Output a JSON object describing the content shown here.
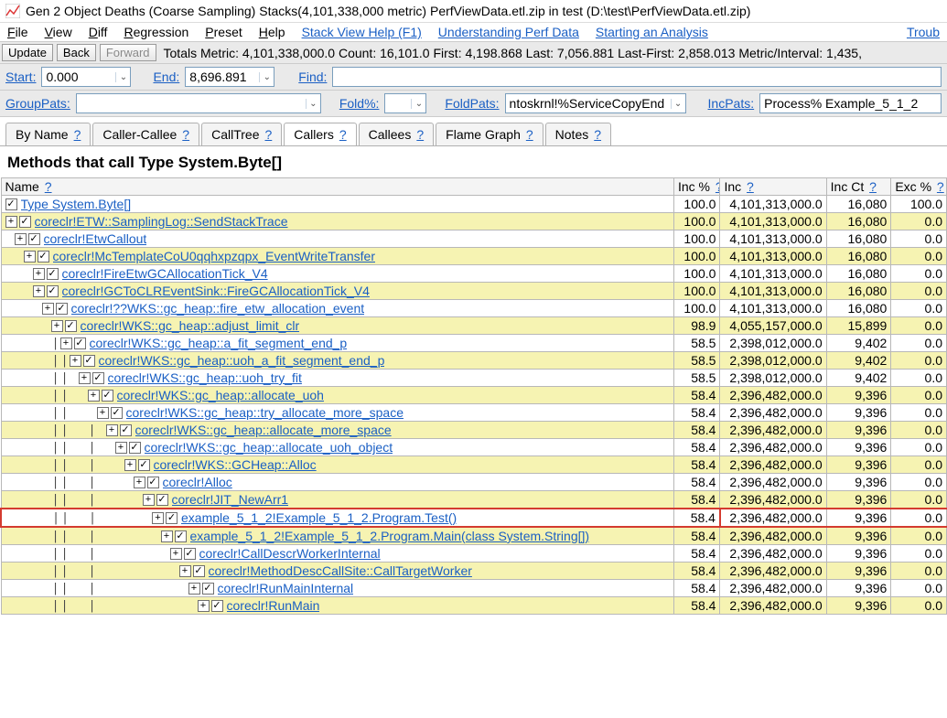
{
  "window": {
    "title": "Gen 2 Object Deaths (Coarse Sampling) Stacks(4,101,338,000 metric) PerfViewData.etl.zip in test (D:\\test\\PerfViewData.etl.zip)"
  },
  "menu": {
    "file": "File",
    "view": "View",
    "diff": "Diff",
    "regression": "Regression",
    "preset": "Preset",
    "help": "Help",
    "stack_view_help": "Stack View Help (F1)",
    "understanding": "Understanding Perf Data",
    "starting": "Starting an Analysis",
    "trouble": "Troub"
  },
  "toolbar": {
    "update": "Update",
    "back": "Back",
    "forward": "Forward",
    "stats": "Totals Metric: 4,101,338,000.0  Count: 16,101.0  First: 4,198.868 Last: 7,056.881  Last-First: 2,858.013  Metric/Interval: 1,435,"
  },
  "filters1": {
    "start_label": "Start:",
    "start_value": "0.000",
    "end_label": "End:",
    "end_value": "8,696.891",
    "find_label": "Find:",
    "find_value": ""
  },
  "filters2": {
    "group_label": "GroupPats:",
    "group_value": "",
    "foldpct_label": "Fold%:",
    "foldpct_value": "",
    "foldpats_label": "FoldPats:",
    "foldpats_value": "ntoskrnl!%ServiceCopyEnd",
    "incpats_label": "IncPats:",
    "incpats_value": "Process% Example_5_1_2"
  },
  "tabs": {
    "byname": "By Name",
    "callercallee": "Caller-Callee",
    "calltree": "CallTree",
    "callers": "Callers",
    "callees": "Callees",
    "flame": "Flame Graph",
    "notes": "Notes",
    "q": "?"
  },
  "heading": "Methods that call Type System.Byte[]",
  "columns": {
    "name": "Name",
    "incpct": "Inc %",
    "inc": "Inc",
    "incct": "Inc Ct",
    "excpct": "Exc %",
    "q": "?"
  },
  "rows": [
    {
      "depth": 0,
      "pipes": "",
      "hl": false,
      "label": "Type System.Byte[]",
      "incpct": "100.0",
      "inc": "4,101,313,000.0",
      "incct": "16,080",
      "excpct": "100.0"
    },
    {
      "depth": 0,
      "pipes": "+",
      "hl": true,
      "label": "coreclr!ETW::SamplingLog::SendStackTrace",
      "incpct": "100.0",
      "inc": "4,101,313,000.0",
      "incct": "16,080",
      "excpct": "0.0"
    },
    {
      "depth": 1,
      "pipes": "+",
      "hl": false,
      "label": "coreclr!EtwCallout",
      "incpct": "100.0",
      "inc": "4,101,313,000.0",
      "incct": "16,080",
      "excpct": "0.0"
    },
    {
      "depth": 2,
      "pipes": "+",
      "hl": true,
      "label": "coreclr!McTemplateCoU0qqhxpzqpx_EventWriteTransfer",
      "incpct": "100.0",
      "inc": "4,101,313,000.0",
      "incct": "16,080",
      "excpct": "0.0"
    },
    {
      "depth": 3,
      "pipes": "+",
      "hl": false,
      "label": "coreclr!FireEtwGCAllocationTick_V4",
      "incpct": "100.0",
      "inc": "4,101,313,000.0",
      "incct": "16,080",
      "excpct": "0.0"
    },
    {
      "depth": 3,
      "pipes": "+",
      "hl": true,
      "label": "coreclr!GCToCLREventSink::FireGCAllocationTick_V4",
      "incpct": "100.0",
      "inc": "4,101,313,000.0",
      "incct": "16,080",
      "excpct": "0.0"
    },
    {
      "depth": 4,
      "pipes": "+",
      "hl": false,
      "label": "coreclr!??WKS::gc_heap::fire_etw_allocation_event",
      "incpct": "100.0",
      "inc": "4,101,313,000.0",
      "incct": "16,080",
      "excpct": "0.0"
    },
    {
      "depth": 5,
      "pipes": "+",
      "hl": true,
      "label": "coreclr!WKS::gc_heap::adjust_limit_clr",
      "incpct": "98.9",
      "inc": "4,055,157,000.0",
      "incct": "15,899",
      "excpct": "0.0"
    },
    {
      "depth": 5,
      "pipes": "|+",
      "hl": false,
      "label": "coreclr!WKS::gc_heap::a_fit_segment_end_p",
      "incpct": "58.5",
      "inc": "2,398,012,000.0",
      "incct": "9,402",
      "excpct": "0.0"
    },
    {
      "depth": 5,
      "pipes": "||+",
      "hl": true,
      "label": "coreclr!WKS::gc_heap::uoh_a_fit_segment_end_p",
      "incpct": "58.5",
      "inc": "2,398,012,000.0",
      "incct": "9,402",
      "excpct": "0.0"
    },
    {
      "depth": 5,
      "pipes": "|| +",
      "hl": false,
      "label": "coreclr!WKS::gc_heap::uoh_try_fit",
      "incpct": "58.5",
      "inc": "2,398,012,000.0",
      "incct": "9,402",
      "excpct": "0.0"
    },
    {
      "depth": 5,
      "pipes": "||  +",
      "hl": true,
      "label": "coreclr!WKS::gc_heap::allocate_uoh",
      "incpct": "58.4",
      "inc": "2,396,482,000.0",
      "incct": "9,396",
      "excpct": "0.0"
    },
    {
      "depth": 5,
      "pipes": "||   +",
      "hl": false,
      "label": "coreclr!WKS::gc_heap::try_allocate_more_space",
      "incpct": "58.4",
      "inc": "2,396,482,000.0",
      "incct": "9,396",
      "excpct": "0.0"
    },
    {
      "depth": 5,
      "pipes": "||  | +",
      "hl": true,
      "label": "coreclr!WKS::gc_heap::allocate_more_space",
      "incpct": "58.4",
      "inc": "2,396,482,000.0",
      "incct": "9,396",
      "excpct": "0.0"
    },
    {
      "depth": 5,
      "pipes": "||  |  +",
      "hl": false,
      "label": "coreclr!WKS::gc_heap::allocate_uoh_object",
      "incpct": "58.4",
      "inc": "2,396,482,000.0",
      "incct": "9,396",
      "excpct": "0.0"
    },
    {
      "depth": 5,
      "pipes": "||  |   +",
      "hl": true,
      "label": "coreclr!WKS::GCHeap::Alloc",
      "incpct": "58.4",
      "inc": "2,396,482,000.0",
      "incct": "9,396",
      "excpct": "0.0"
    },
    {
      "depth": 5,
      "pipes": "||  |    +",
      "hl": false,
      "label": "coreclr!Alloc",
      "incpct": "58.4",
      "inc": "2,396,482,000.0",
      "incct": "9,396",
      "excpct": "0.0"
    },
    {
      "depth": 5,
      "pipes": "||  |     +",
      "hl": true,
      "label": "coreclr!JIT_NewArr1",
      "incpct": "58.4",
      "inc": "2,396,482,000.0",
      "incct": "9,396",
      "excpct": "0.0"
    },
    {
      "depth": 5,
      "pipes": "||  |      +",
      "hl": false,
      "red": true,
      "label": "example_5_1_2!Example_5_1_2.Program.Test()",
      "incpct": "58.4",
      "inc": "2,396,482,000.0",
      "incct": "9,396",
      "excpct": "0.0"
    },
    {
      "depth": 5,
      "pipes": "||  |       +",
      "hl": true,
      "label": "example_5_1_2!Example_5_1_2.Program.Main(class System.String[])",
      "incpct": "58.4",
      "inc": "2,396,482,000.0",
      "incct": "9,396",
      "excpct": "0.0"
    },
    {
      "depth": 5,
      "pipes": "||  |        +",
      "hl": false,
      "label": "coreclr!CallDescrWorkerInternal",
      "incpct": "58.4",
      "inc": "2,396,482,000.0",
      "incct": "9,396",
      "excpct": "0.0"
    },
    {
      "depth": 5,
      "pipes": "||  |         +",
      "hl": true,
      "label": "coreclr!MethodDescCallSite::CallTargetWorker",
      "incpct": "58.4",
      "inc": "2,396,482,000.0",
      "incct": "9,396",
      "excpct": "0.0"
    },
    {
      "depth": 5,
      "pipes": "||  |          +",
      "hl": false,
      "label": "coreclr!RunMainInternal",
      "incpct": "58.4",
      "inc": "2,396,482,000.0",
      "incct": "9,396",
      "excpct": "0.0"
    },
    {
      "depth": 5,
      "pipes": "||  |           +",
      "hl": true,
      "label": "coreclr!RunMain",
      "incpct": "58.4",
      "inc": "2,396,482,000.0",
      "incct": "9,396",
      "excpct": "0.0"
    }
  ]
}
